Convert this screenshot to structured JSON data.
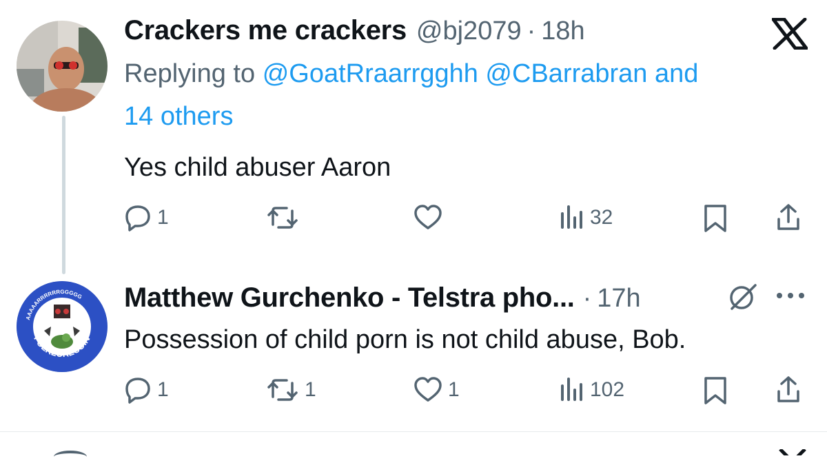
{
  "colors": {
    "accent": "#1d9bf0",
    "muted": "#536471",
    "text": "#0f1419"
  },
  "tweet1": {
    "display_name": "Crackers me crackers",
    "handle": "@bj2079",
    "sep": "·",
    "time": "18h",
    "replying_prefix": "Replying to",
    "mention1": "@GoatRraarrgghh",
    "mention2": "@CBarrabran",
    "and_text": "and",
    "others": "14 others",
    "text": "Yes child abuser Aaron",
    "actions": {
      "replies": "1",
      "reposts": "",
      "likes": "",
      "views": "32"
    },
    "header_icon": "x-logo-icon"
  },
  "tweet2": {
    "display_name": "Matthew Gurchenko - Telstra pho...",
    "sep": "·",
    "time": "17h",
    "text": "Possession of child porn is not child abuse, Bob.",
    "actions": {
      "replies": "1",
      "reposts": "1",
      "likes": "1",
      "views": "102"
    },
    "avatar_text": "FOLKLORECOIN",
    "avatar_ring_text": "AAAAARRRRRRGGGGG"
  }
}
